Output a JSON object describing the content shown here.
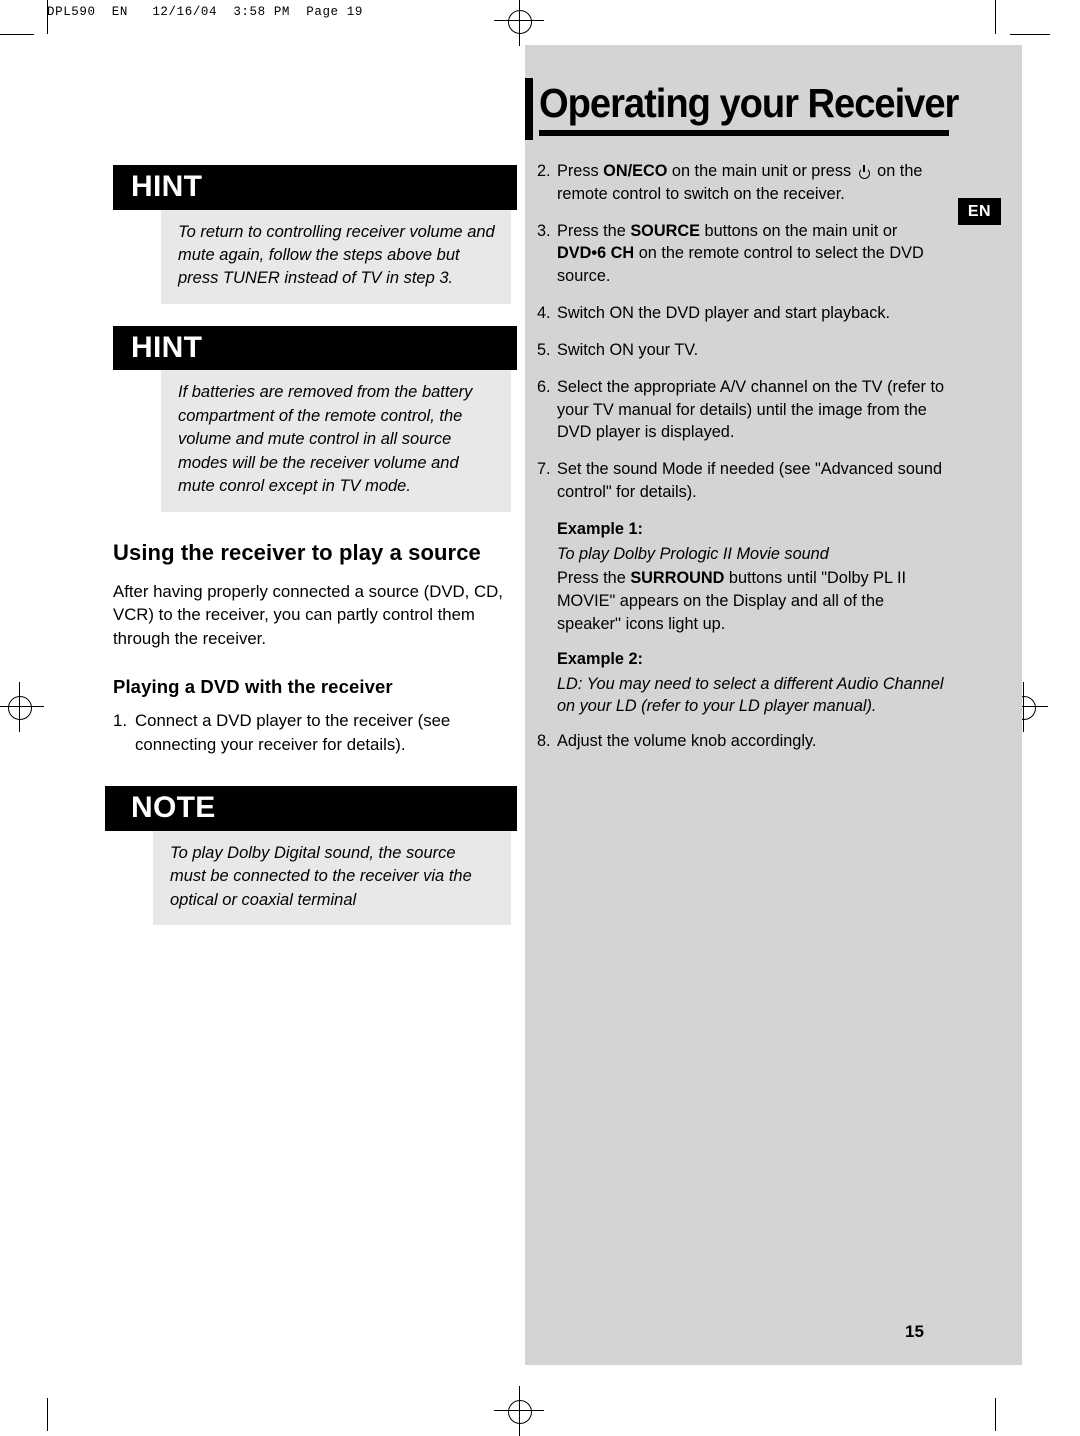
{
  "slug": "DPL590  EN   12/16/04  3:58 PM  Page 19",
  "header": {
    "title": "Operating your Receiver",
    "language_tab": "EN"
  },
  "page_number": "15",
  "left_column": {
    "callouts": [
      {
        "heading": "HINT",
        "body": "To return to controlling receiver volume and mute again, follow the steps above but press TUNER instead of TV in step 3."
      },
      {
        "heading": "HINT",
        "body": "If batteries are removed from the battery compartment of the remote control, the volume and mute control in all source modes will be the receiver volume and mute conrol except in TV mode."
      },
      {
        "heading": "NOTE",
        "body": "To play Dolby Digital sound, the source must be connected to the receiver via the optical or coaxial terminal"
      }
    ],
    "section_title": "Using the receiver to play a source",
    "section_body": "After having properly connected a source (DVD, CD, VCR) to the receiver, you can partly control them through the receiver.",
    "subsection_title": "Playing a DVD with the receiver",
    "step1_num": "1.",
    "step1_text": "Connect a DVD player to the receiver (see connecting your receiver for details)."
  },
  "right_column": {
    "steps": [
      {
        "num": "2.",
        "parts": [
          {
            "t": "Press ",
            "s": "n"
          },
          {
            "t": "ON/ECO",
            "s": "b"
          },
          {
            "t": " on the main unit or press ",
            "s": "n"
          },
          {
            "t": "POWER_ICON",
            "s": "icon"
          },
          {
            "t": " on the remote control to switch on the receiver.",
            "s": "n"
          }
        ]
      },
      {
        "num": "3.",
        "parts": [
          {
            "t": "Press the ",
            "s": "n"
          },
          {
            "t": "SOURCE",
            "s": "b"
          },
          {
            "t": " buttons on the main unit or ",
            "s": "n"
          },
          {
            "t": "DVD•6 CH",
            "s": "b"
          },
          {
            "t": " on the remote control to select the DVD source.",
            "s": "n"
          }
        ]
      },
      {
        "num": "4.",
        "parts": [
          {
            "t": "Switch ON the DVD player and start playback.",
            "s": "n"
          }
        ]
      },
      {
        "num": "5.",
        "parts": [
          {
            "t": "Switch ON your TV.",
            "s": "n"
          }
        ]
      },
      {
        "num": "6.",
        "parts": [
          {
            "t": "Select the appropriate A/V channel on the TV (refer to your TV manual for details) until the image from the DVD player is displayed.",
            "s": "n"
          }
        ]
      },
      {
        "num": "7.",
        "parts": [
          {
            "t": "Set the sound Mode if needed (see \"Advanced sound control\" for details).",
            "s": "n"
          }
        ]
      }
    ],
    "example1": {
      "label": "Example 1:",
      "italic_line": "To play Dolby Prologic II Movie sound",
      "parts": [
        {
          "t": "Press the ",
          "s": "n"
        },
        {
          "t": "SURROUND",
          "s": "b"
        },
        {
          "t": " buttons until \"Dolby PL II MOVIE\" appears on the Display and all of the speaker'' icons light up.",
          "s": "n"
        }
      ]
    },
    "example2": {
      "label": "Example 2:",
      "parts": [
        {
          "t": "LD:",
          "s": "i"
        },
        {
          "t": " You may need to select a different Audio Channel on your LD (refer to your LD player manual).",
          "s": "i"
        }
      ]
    },
    "step8": {
      "num": "8.",
      "text": "Adjust the volume knob accordingly."
    }
  }
}
